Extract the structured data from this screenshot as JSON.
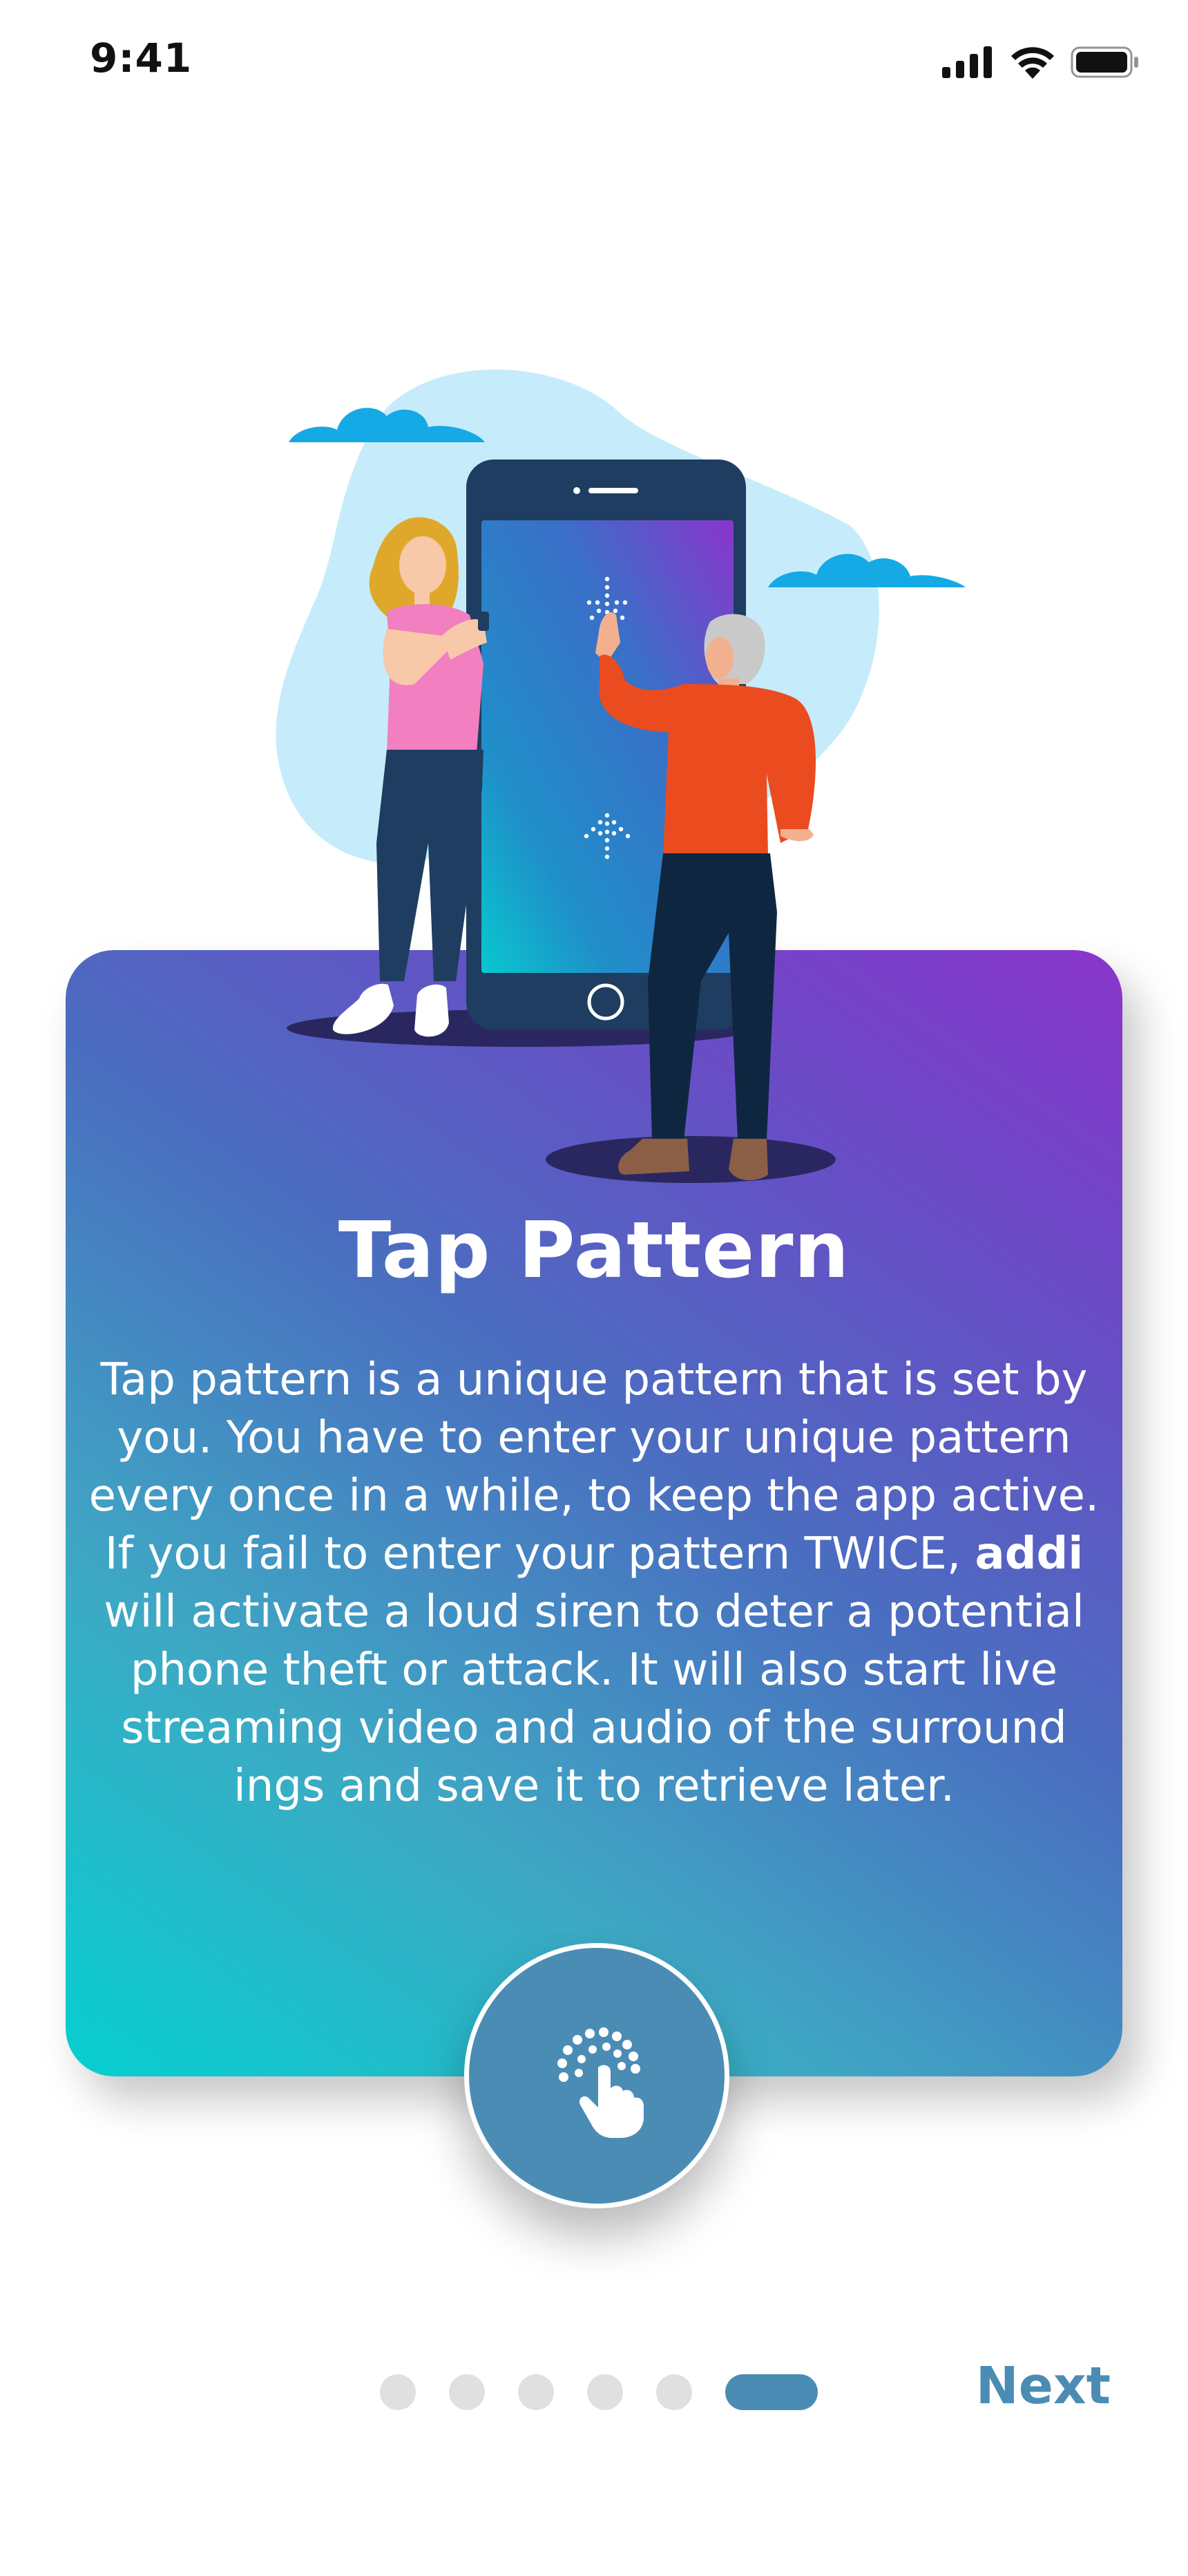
{
  "status_bar": {
    "time": "9:41",
    "icons": [
      "signal-icon",
      "wifi-icon",
      "battery-icon"
    ]
  },
  "hero": {
    "icons": [
      "cloud-icon",
      "phone-illustration",
      "woman-figure",
      "man-figure",
      "tap-pattern-dots-icon",
      "up-arrow-dots-icon"
    ]
  },
  "card": {
    "title": "Tap Pattern",
    "body_before": "Tap pattern is a unique pattern that is set by you. You have to enter your unique pattern every once in a while, to keep the app active. If you fail to enter your pattern TWICE, ",
    "brand": "addi",
    "body_after": " will activate a loud siren to deter a potential phone theft or attack. It will also start live streaming video and audio of the surround ings and save it to retrieve later.",
    "gradient": [
      "#05cfd0",
      "#4a6ec0",
      "#8a35cc"
    ]
  },
  "tap_button": {
    "icon": "tap-hand-icon"
  },
  "pager": {
    "total": 6,
    "active_index": 5
  },
  "next_label": "Next",
  "colors": {
    "accent": "#4b8cb5",
    "title_text": "#ffffff",
    "dot_inactive": "#e0e0e0"
  }
}
